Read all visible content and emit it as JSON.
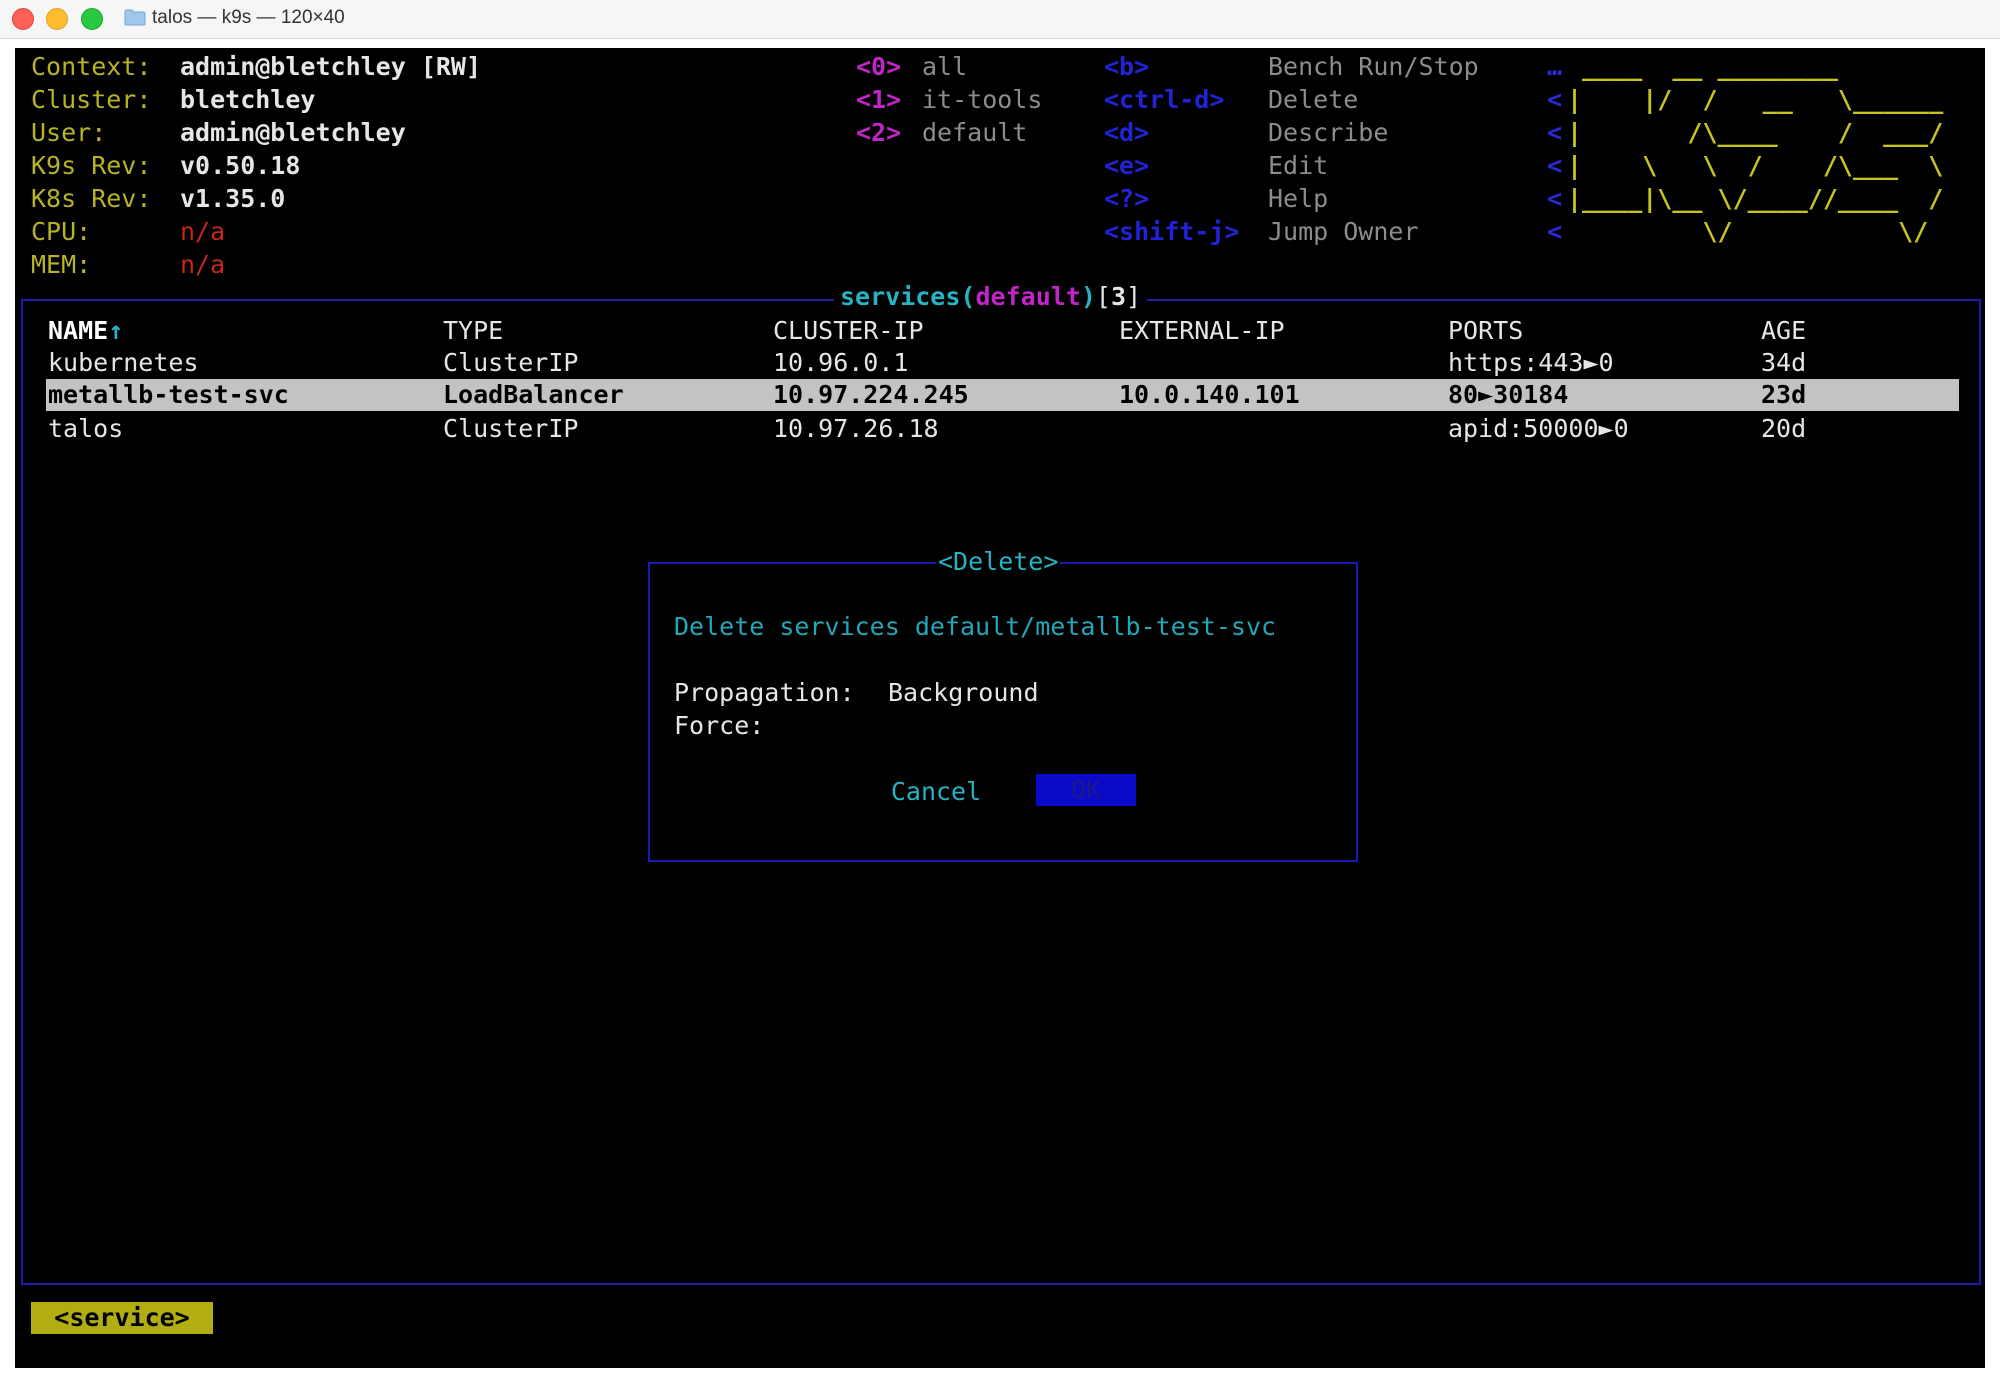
{
  "window": {
    "title": "talos — k9s — 120×40"
  },
  "header": {
    "info": [
      {
        "key": "Context:",
        "value": "admin@bletchley [RW]",
        "value_color": "white"
      },
      {
        "key": "Cluster:",
        "value": "bletchley",
        "value_color": "white"
      },
      {
        "key": "User:",
        "value": "admin@bletchley",
        "value_color": "white"
      },
      {
        "key": "K9s Rev:",
        "value": "v0.50.18",
        "value_color": "white"
      },
      {
        "key": "K8s Rev:",
        "value": "v1.35.0",
        "value_color": "white"
      },
      {
        "key": "CPU:",
        "value": "n/a",
        "value_color": "red"
      },
      {
        "key": "MEM:",
        "value": "n/a",
        "value_color": "red"
      }
    ],
    "namespaces": [
      {
        "key": "<0>",
        "label": "all"
      },
      {
        "key": "<1>",
        "label": "it-tools"
      },
      {
        "key": "<2>",
        "label": "default"
      }
    ],
    "shortcuts": [
      {
        "key": "<b>",
        "label": "Bench Run/Stop"
      },
      {
        "key": "<ctrl-d>",
        "label": "Delete"
      },
      {
        "key": "<d>",
        "label": "Describe"
      },
      {
        "key": "<e>",
        "label": "Edit"
      },
      {
        "key": "<?>",
        "label": "Help"
      },
      {
        "key": "<shift-j>",
        "label": "Jump Owner"
      }
    ],
    "logo_lines": [
      " ____  __ ________       ",
      "|    |/  /   __   \\______",
      "|       /\\____    /  ___/",
      "|    \\   \\  /    /\\___  \\",
      "|____|\\__ \\/____//____  /",
      "         \\/           \\/ "
    ],
    "logo_prefixes": [
      "…",
      "<",
      "<",
      "<",
      "<",
      "<"
    ]
  },
  "table": {
    "resource": "services",
    "namespace": "default",
    "count": "3",
    "columns": [
      "NAME",
      "TYPE",
      "CLUSTER-IP",
      "EXTERNAL-IP",
      "PORTS",
      "AGE"
    ],
    "sort_indicator": "↑",
    "rows": [
      {
        "name": "kubernetes",
        "type": "ClusterIP",
        "cluster_ip": "10.96.0.1",
        "external_ip": "",
        "ports": "https:443►0",
        "age": "34d",
        "selected": false
      },
      {
        "name": "metallb-test-svc",
        "type": "LoadBalancer",
        "cluster_ip": "10.97.224.245",
        "external_ip": "10.0.140.101",
        "ports": "80►30184",
        "age": "23d",
        "selected": true
      },
      {
        "name": "talos",
        "type": "ClusterIP",
        "cluster_ip": "10.97.26.18",
        "external_ip": "",
        "ports": "apid:50000►0",
        "age": "20d",
        "selected": false
      }
    ]
  },
  "dialog": {
    "title": "<Delete>",
    "message": "Delete services default/metallb-test-svc",
    "propagation_label": "Propagation:",
    "propagation_value": "Background",
    "force_label": "Force:",
    "cancel_label": "Cancel",
    "ok_label": "OK"
  },
  "crumb": {
    "label": "<service>"
  },
  "colors": {
    "background": "#000000",
    "label_yellow": "#b7b327",
    "accent_cyan": "#26b3c4",
    "accent_magenta": "#c225c7",
    "border_blue": "#1b1bb0",
    "ok_button_bg": "#0a0ac8",
    "selected_row_bg": "#c3c3c3",
    "crumb_bg": "#b1ad13",
    "error_red": "#c4271c"
  }
}
